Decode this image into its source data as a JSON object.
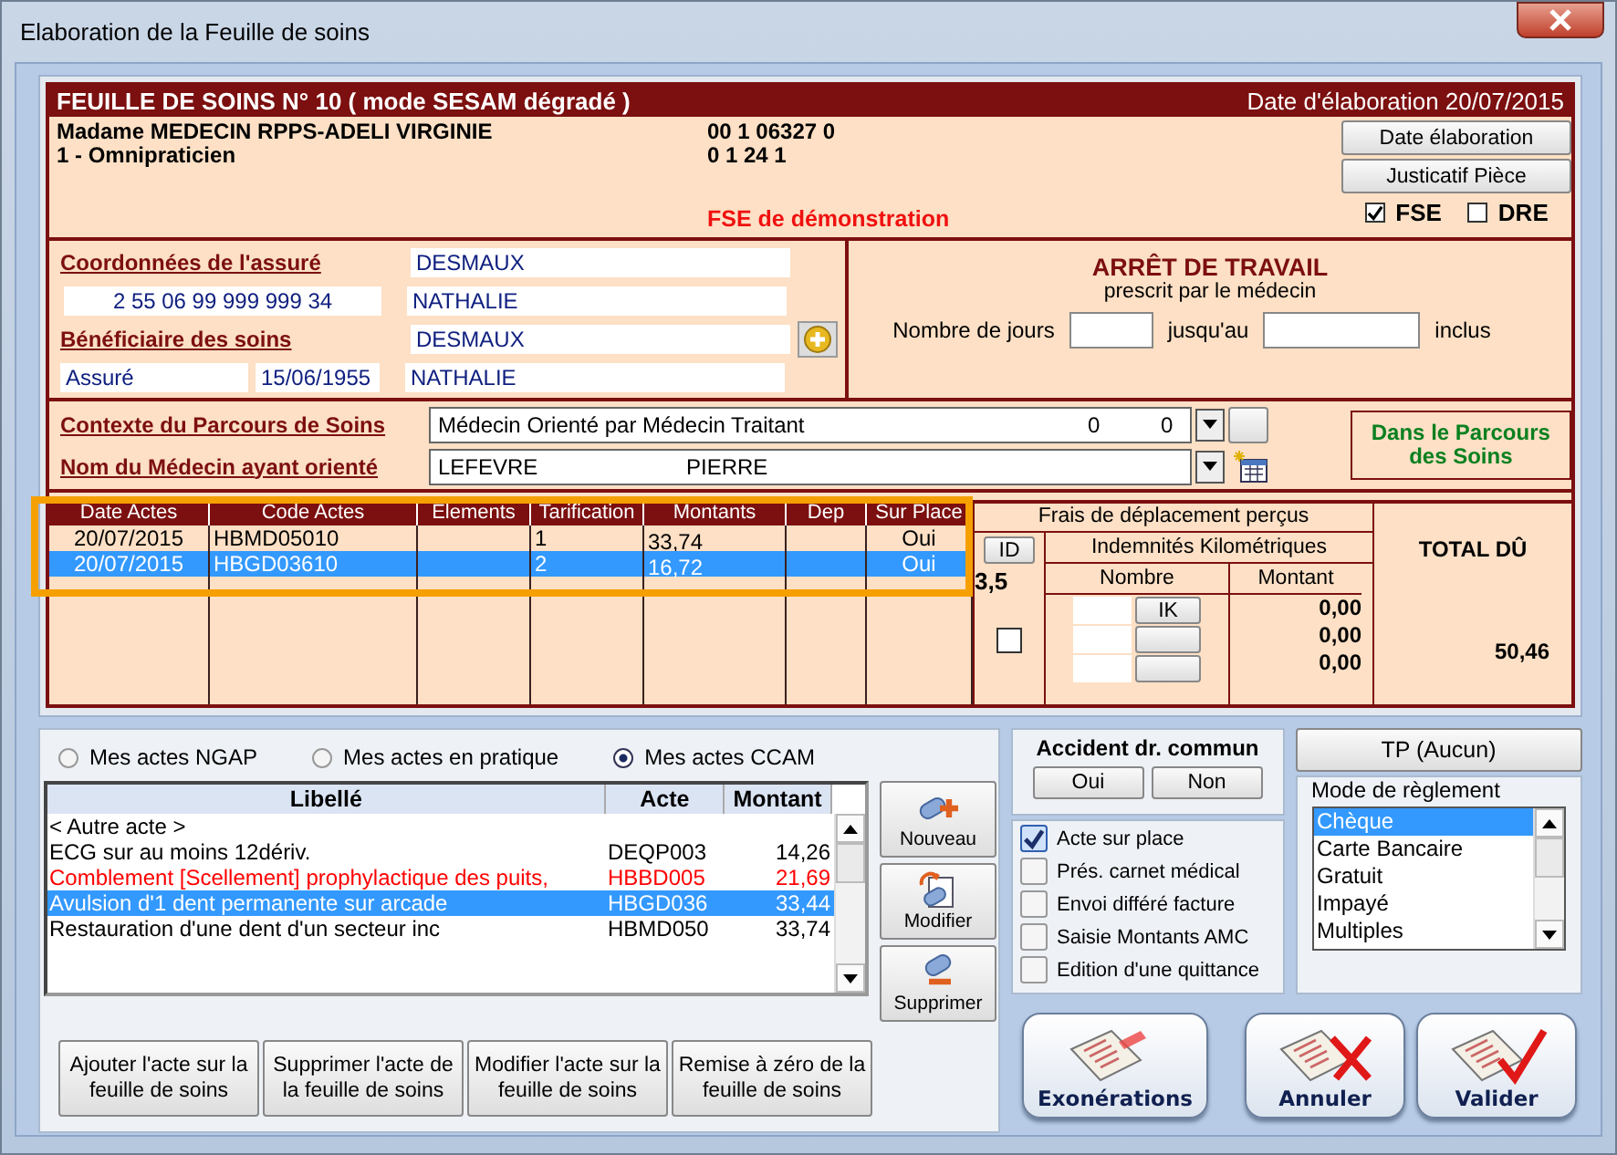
{
  "window": {
    "title": "Elaboration de la Feuille de soins"
  },
  "header": {
    "title": "FEUILLE DE SOINS  N° 10 ( mode SESAM dégradé )",
    "date": "Date d'élaboration 20/07/2015"
  },
  "practitioner": {
    "name": "Madame MEDECIN RPPS-ADELI VIRGINIE",
    "specialty": "1 - Omnipraticien",
    "number_1": "00 1 06327 0",
    "number_2": "0 1 24 1",
    "notice": "FSE de démonstration"
  },
  "header_buttons": [
    "Date élaboration",
    "Justicatif Pièce"
  ],
  "sheet_types": [
    {
      "label": "FSE",
      "checked": true
    },
    {
      "label": "DRE",
      "checked": false
    }
  ],
  "insured": {
    "section_label": "Coordonnées de l'assuré",
    "last_name": "DESMAUX",
    "ssn": "2 55 06 99 999 999 34",
    "first_name": "NATHALIE"
  },
  "beneficiary": {
    "section_label": "Bénéficiaire des soins",
    "last_name": "DESMAUX",
    "relation": "Assuré",
    "birth_date": "15/06/1955",
    "first_name": "NATHALIE"
  },
  "work_stop": {
    "title": "ARRÊT DE TRAVAIL",
    "subtitle": "prescrit par le médecin",
    "days_label": "Nombre de jours",
    "until_label": "jusqu'au",
    "inclusive_label": "inclus"
  },
  "care_path": {
    "context_label": "Contexte du Parcours de Soins",
    "context_value": "Médecin Orienté par Médecin Traitant",
    "context_num_1": "0",
    "context_num_2": "0",
    "doctor_label": "Nom du Médecin ayant orienté",
    "doctor_last": "LEFEVRE",
    "doctor_first": "PIERRE",
    "status": "Dans le Parcours des Soins"
  },
  "acts_table": {
    "columns": [
      "Date Actes",
      "Code Actes",
      "Elements",
      "Tarification",
      "Montants",
      "Dep",
      "Sur Place"
    ],
    "rows": [
      {
        "date": "20/07/2015",
        "code": "HBMD05010",
        "tarification": "1",
        "amount": "33,74",
        "on_site": "Oui",
        "selected": false
      },
      {
        "date": "20/07/2015",
        "code": "HBGD03610",
        "tarification": "2",
        "amount": "16,72",
        "on_site": "Oui",
        "selected": true
      }
    ]
  },
  "travel": {
    "title": "Frais de déplacement perçus",
    "id_button": "ID",
    "id_value": "3,5",
    "km_title": "Indemnités Kilométriques",
    "count_label": "Nombre",
    "amount_label": "Montant",
    "ik_button": "IK",
    "checked": false,
    "amounts": [
      "0,00",
      "0,00",
      "0,00"
    ]
  },
  "total": {
    "label": "TOTAL DÛ",
    "value": "50,46"
  },
  "act_sources": [
    {
      "label": "Mes actes NGAP",
      "selected": false
    },
    {
      "label": "Mes actes en pratique",
      "selected": false
    },
    {
      "label": "Mes actes CCAM",
      "selected": true
    }
  ],
  "acts_list": {
    "columns": [
      "Libellé",
      "Acte",
      "Montant"
    ],
    "rows": [
      {
        "label": "< Autre acte >",
        "color": "#000000",
        "selected": false
      },
      {
        "label": "ECG sur au moins 12dériv.",
        "code": "DEQP003",
        "amount": "14,26",
        "color": "#000000",
        "selected": false
      },
      {
        "label": "Comblement [Scellement] prophylactique des puits,",
        "code": "HBBD005",
        "amount": "21,69",
        "color": "#ff0000",
        "selected": false
      },
      {
        "label": "Avulsion d'1 dent permanente sur arcade",
        "code": "HBGD036",
        "amount": "33,44",
        "selected": true
      },
      {
        "label": "Restauration d'une dent d'un secteur inc",
        "code": "HBMD050",
        "amount": "33,74",
        "color": "#000000",
        "selected": false
      }
    ]
  },
  "list_buttons": [
    {
      "label": "Nouveau",
      "kind": "new"
    },
    {
      "label": "Modifier",
      "kind": "edit"
    },
    {
      "label": "Supprimer",
      "kind": "delete"
    }
  ],
  "sheet_buttons": [
    "Ajouter l'acte sur la feuille de soins",
    "Supprimer l'acte de la feuille de soins",
    "Modifier l'acte sur la feuille de soins",
    "Remise à zéro de la feuille de soins"
  ],
  "accident": {
    "title": "Accident dr. commun",
    "buttons": [
      "Oui",
      "Non"
    ]
  },
  "options": [
    {
      "label": "Acte sur place",
      "checked": true
    },
    {
      "label": "Prés. carnet médical",
      "checked": false
    },
    {
      "label": "Envoi différé facture",
      "checked": false
    },
    {
      "label": "Saisie Montants AMC",
      "checked": false
    },
    {
      "label": "Edition d'une quittance",
      "checked": false
    }
  ],
  "tp_button": "TP (Aucun)",
  "payment": {
    "title": "Mode de règlement",
    "items": [
      {
        "label": "Chèque",
        "selected": true
      },
      {
        "label": "Carte Bancaire",
        "selected": false
      },
      {
        "label": "Gratuit",
        "selected": false
      },
      {
        "label": "Impayé",
        "selected": false
      },
      {
        "label": "Multiples",
        "selected": false
      }
    ]
  },
  "action_buttons": [
    {
      "label": "Exonérations",
      "kind": "exemption"
    },
    {
      "label": "Annuler",
      "kind": "cancel"
    },
    {
      "label": "Valider",
      "kind": "validate"
    }
  ]
}
